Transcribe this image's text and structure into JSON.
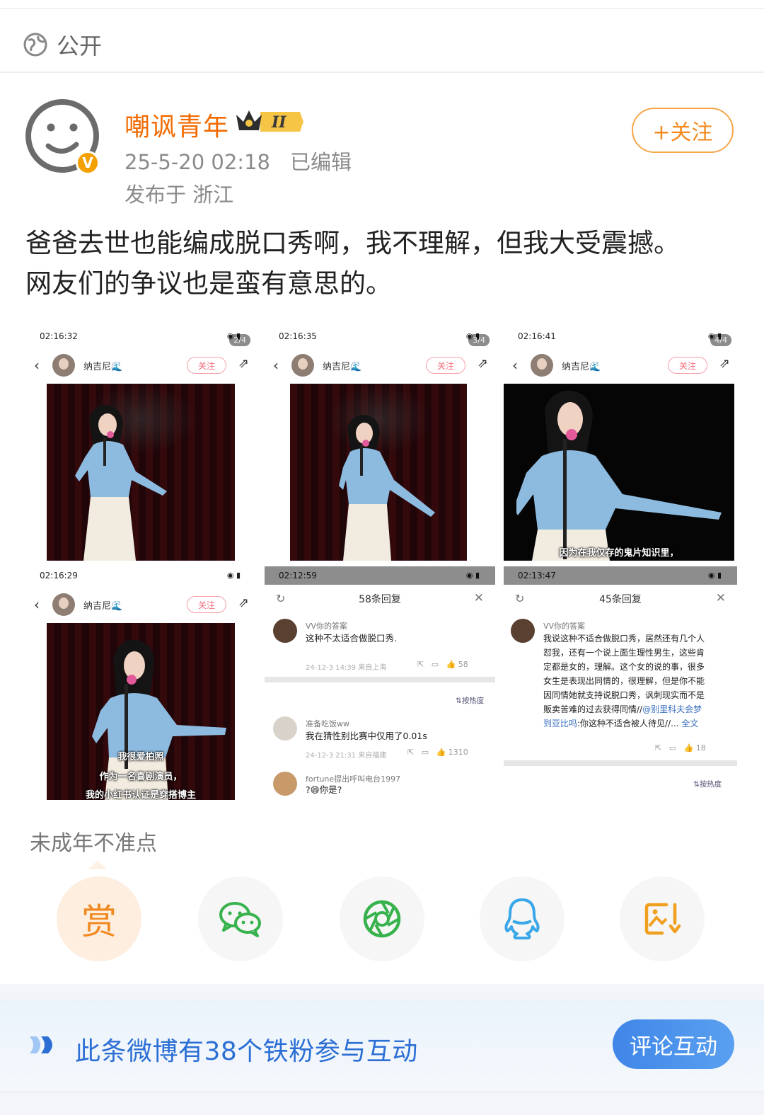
{
  "visibility": {
    "label": "公开"
  },
  "author": {
    "name": "嘲讽青年",
    "level_badge": "II",
    "verified_mark": "V",
    "time": "25-5-20 02:18",
    "edited": "已编辑",
    "location": "发布于 浙江"
  },
  "follow_button": {
    "label": "+关注"
  },
  "post": {
    "text_line1": "爸爸去世也能编成脱口秀啊，我不理解，但我大受震撼。",
    "text_line2": "网友们的争议也是蛮有意思的。"
  },
  "images": {
    "shots": [
      {
        "time": "02:16:32",
        "user": "纳吉尼🌊",
        "follow": "关注",
        "counter": "2/4"
      },
      {
        "time": "02:16:35",
        "user": "纳吉尼🌊",
        "follow": "关注",
        "counter": "3/4"
      },
      {
        "time": "02:16:41",
        "user": "纳吉尼🌊",
        "follow": "关注",
        "counter": "4/4",
        "caption": "因为在我仅存的鬼片知识里，"
      },
      {
        "time": "02:16:29",
        "user": "纳吉尼🌊",
        "follow": "关注",
        "caption1": "我很爱拍照",
        "caption2": "作为一名喜剧演员，",
        "caption3": "我的小红书认证是穿搭博主"
      }
    ],
    "reply58": {
      "time": "02:12:59",
      "title": "58条回复",
      "c1_name": "VV你的答案",
      "c1_text": "这种不太适合做脱口秀.",
      "c1_meta": "24-12-3 14:39 来自上海",
      "c1_likes": "58",
      "sort": "按热度",
      "c2_name": "准备吃饭ww",
      "c2_text": "我在猜性别比赛中仅用了0.01s",
      "c2_meta": "24-12-3 21:31 来自福建",
      "c2_likes": "1310",
      "c3_name": "fortune提出呼叫电台1997",
      "c3_text": "?😄你是?"
    },
    "reply45": {
      "time": "02:13:47",
      "title": "45条回复",
      "c1_name": "VV你的答案",
      "c1_line1": "我说这种不适合做脱口秀，居然还有几个人",
      "c1_line2": "怼我，还有一个说上面生理性男生，这些肯",
      "c1_line3": "定都是女的，理解。这个女的说的事，很多",
      "c1_line4": "女生是表现出同情的，很理解，但是你不能",
      "c1_line5": "因同情她就支持说脱口秀，讽刺现实而不是",
      "c1_line6a": "贩卖苦难的过去获得同情//",
      "c1_line6b": "@别里科夫会梦",
      "c1_line7a": "到亚比吗",
      "c1_line7b": ":你这种不适合被人待见//... ",
      "c1_fulltext": "全文",
      "c1_likes": "18",
      "sort": "按热度"
    }
  },
  "age_notice": "未成年不准点",
  "share": {
    "reward": "赏",
    "icons": [
      "wechat-icon",
      "moments-icon",
      "qq-icon",
      "save-image-icon"
    ]
  },
  "banner": {
    "text": "此条微博有38个铁粉参与互动",
    "button": "评论互动"
  },
  "colors": {
    "accent_orange": "#f26a00",
    "link_blue": "#2c6fd4",
    "wechat_green": "#37b24d",
    "qq_blue": "#3aa7e8"
  }
}
